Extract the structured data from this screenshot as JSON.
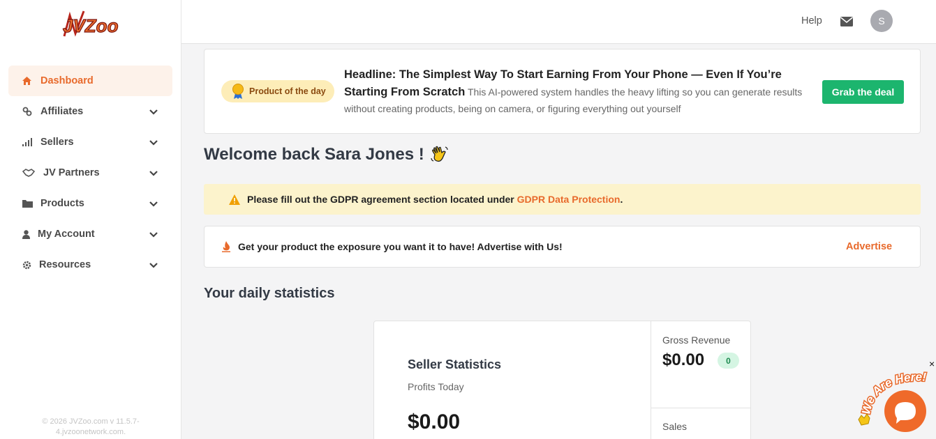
{
  "brand": {
    "logo_text": "JVZoo",
    "accent": "#e86a2c"
  },
  "sidebar": {
    "items": [
      {
        "label": "Dashboard",
        "icon": "home-icon",
        "active": true,
        "expandable": false
      },
      {
        "label": "Affiliates",
        "icon": "link-icon",
        "active": false,
        "expandable": true
      },
      {
        "label": "Sellers",
        "icon": "signal-icon",
        "active": false,
        "expandable": true
      },
      {
        "label": "JV Partners",
        "icon": "handshake-icon",
        "active": false,
        "expandable": true
      },
      {
        "label": "Products",
        "icon": "folder-icon",
        "active": false,
        "expandable": true
      },
      {
        "label": "My Account",
        "icon": "user-icon",
        "active": false,
        "expandable": true
      },
      {
        "label": "Resources",
        "icon": "gear-icon",
        "active": false,
        "expandable": true
      }
    ],
    "footer": "© 2026 JVZoo.com v 11.5.7-4.jvzoonetwork.com."
  },
  "header": {
    "help_label": "Help",
    "avatar_initial": "S"
  },
  "product_of_day": {
    "badge": "Product of the day",
    "headline": "Headline: The Simplest Way To Start Earning From Your Phone — Even If You’re Starting From Scratch",
    "description": "This AI-powered system handles the heavy lifting so you can generate results without creating products, being on camera, or figuring everything out yourself",
    "button": "Grab the deal"
  },
  "welcome": {
    "text": "Welcome back Sara Jones !"
  },
  "gdpr_alert": {
    "text": "Please fill out the GDPR agreement section located under",
    "link": "GDPR Data Protection",
    "suffix": "."
  },
  "advertise": {
    "text": "Get your product the exposure you want it to have! Advertise with Us!",
    "link": "Advertise"
  },
  "daily_stats": {
    "title": "Your daily statistics",
    "seller": {
      "title": "Seller Statistics",
      "subtitle": "Profits Today",
      "value": "$0.00"
    },
    "gross_revenue": {
      "label": "Gross Revenue",
      "value": "$0.00",
      "count": "0"
    },
    "sales": {
      "label": "Sales"
    }
  },
  "chat": {
    "bubble_text": "We Are Here!",
    "close": "×"
  }
}
